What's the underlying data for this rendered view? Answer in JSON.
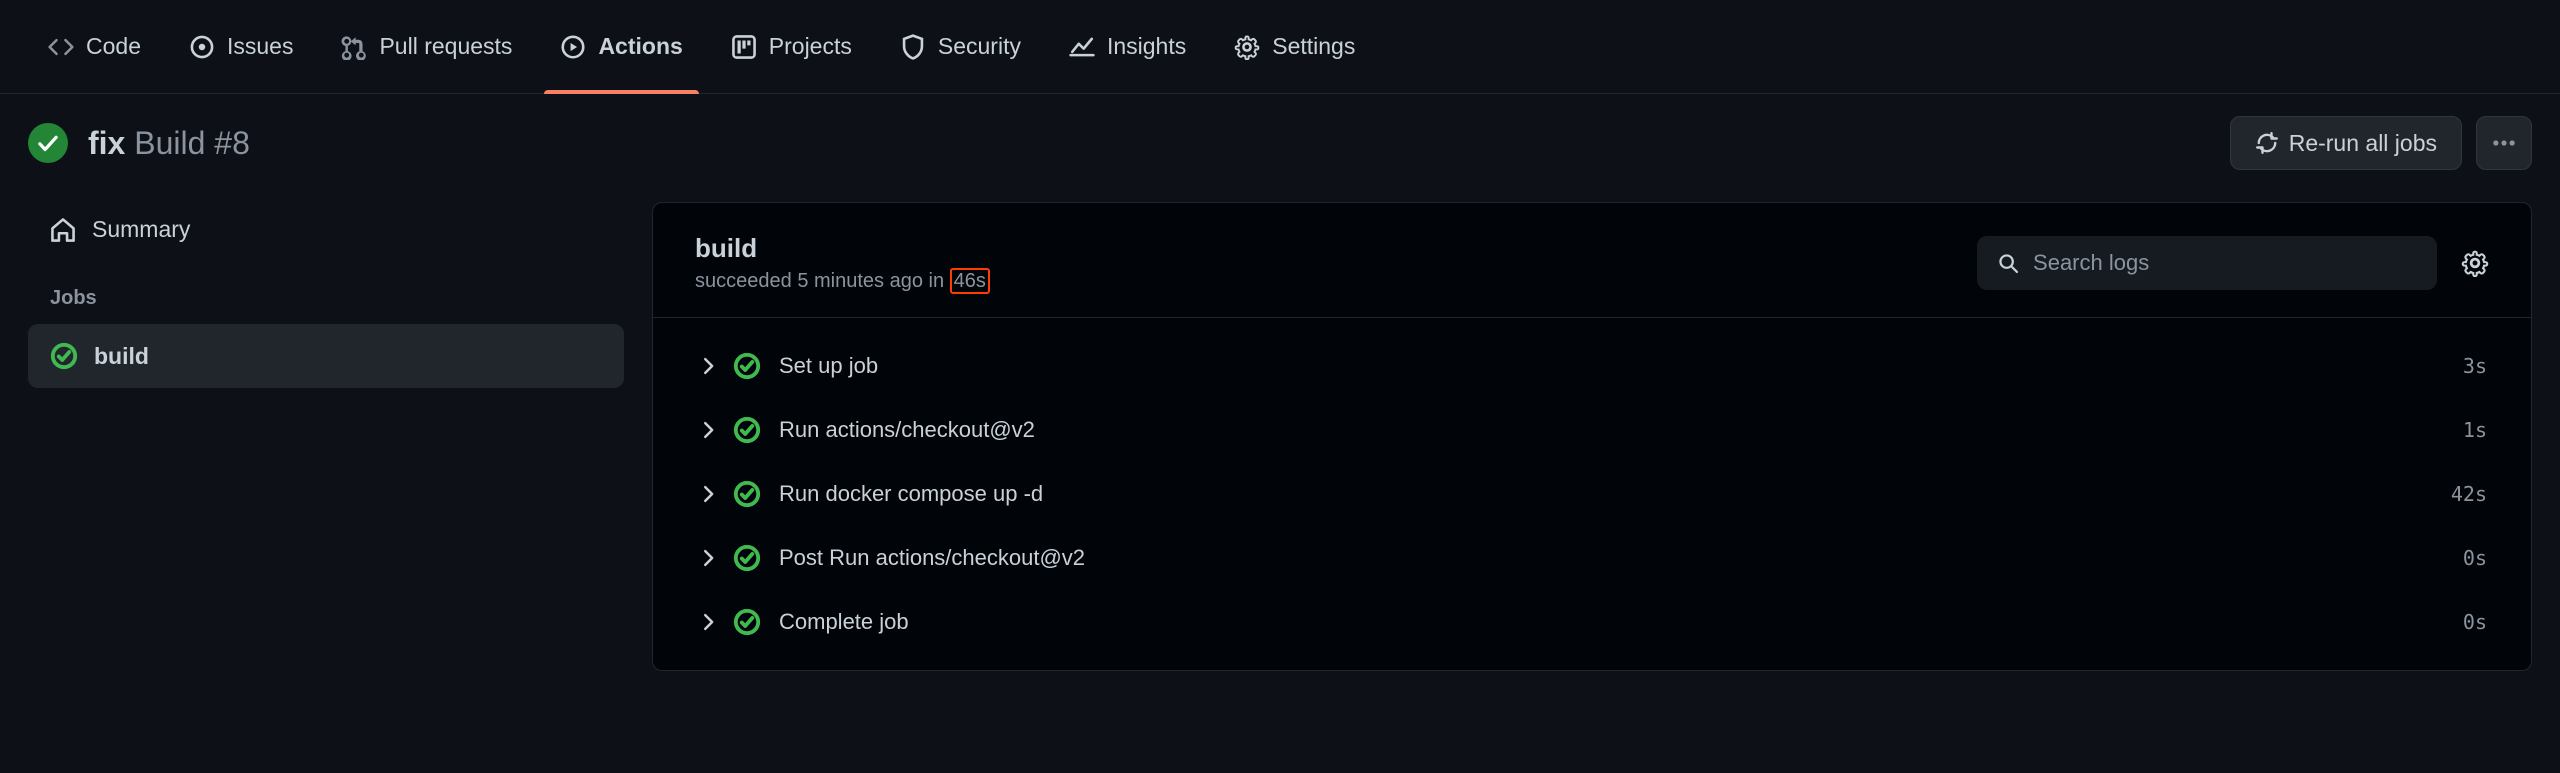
{
  "nav": {
    "tabs": [
      {
        "label": "Code"
      },
      {
        "label": "Issues"
      },
      {
        "label": "Pull requests"
      },
      {
        "label": "Actions"
      },
      {
        "label": "Projects"
      },
      {
        "label": "Security"
      },
      {
        "label": "Insights"
      },
      {
        "label": "Settings"
      }
    ],
    "active_index": 3
  },
  "run": {
    "commit_message": "fix",
    "workflow_name": "Build",
    "run_number": "#8",
    "rerun_label": "Re-run all jobs"
  },
  "sidebar": {
    "summary_label": "Summary",
    "jobs_heading": "Jobs",
    "jobs": [
      {
        "name": "build",
        "active": true
      }
    ]
  },
  "panel": {
    "job_name": "build",
    "status_prefix": "succeeded",
    "status_time_ago": "5 minutes ago",
    "status_in": "in",
    "duration": "46s",
    "search_placeholder": "Search logs"
  },
  "steps": [
    {
      "name": "Set up job",
      "duration": "3s"
    },
    {
      "name": "Run actions/checkout@v2",
      "duration": "1s"
    },
    {
      "name": "Run docker compose up -d",
      "duration": "42s"
    },
    {
      "name": "Post Run actions/checkout@v2",
      "duration": "0s"
    },
    {
      "name": "Complete job",
      "duration": "0s"
    }
  ]
}
